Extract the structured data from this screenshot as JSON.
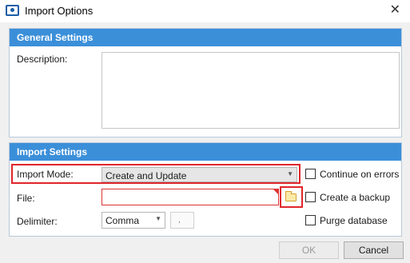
{
  "window": {
    "title": "Import Options",
    "close_glyph": "✕"
  },
  "general_settings": {
    "header": "General Settings",
    "description_label": "Description:"
  },
  "import_settings": {
    "header": "Import Settings",
    "import_mode_label": "Import Mode:",
    "import_mode_value": "Create and Update",
    "file_label": "File:",
    "delimiter_label": "Delimiter:",
    "delimiter_value": "Comma",
    "delimiter_char": ",",
    "options": [
      {
        "label": "Continue on errors",
        "checked": false
      },
      {
        "label": "Create a backup",
        "checked": false
      },
      {
        "label": "Purge database",
        "checked": false
      }
    ]
  },
  "buttons": {
    "ok": "OK",
    "cancel": "Cancel"
  },
  "icons": {
    "app": "import-options-app-icon",
    "close": "close-icon",
    "dropdown": "chevron-down-icon",
    "folder": "folder-icon"
  },
  "colors": {
    "header_blue": "#3b8fd9",
    "highlight_red": "#e0262b",
    "folder_yellow": "#fbe9a8"
  }
}
